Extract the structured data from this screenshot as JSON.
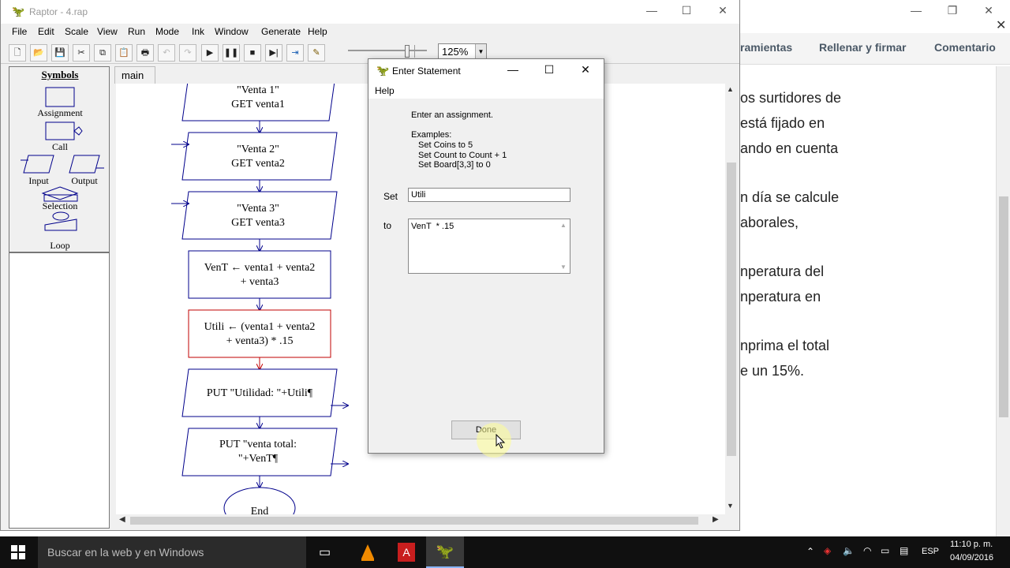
{
  "pdf": {
    "tools": [
      "ramientas",
      "Rellenar y firmar",
      "Comentario"
    ],
    "lines": [
      "os surtidores de",
      "está fijado en",
      "ando en cuenta",
      "n día se calcule",
      "aborales,",
      "nperatura del",
      "nperatura en",
      "nprima el total",
      "e un 15%."
    ]
  },
  "raptor": {
    "title": "Raptor - 4.rap",
    "menu": [
      "File",
      "Edit",
      "Scale",
      "View",
      "Run",
      "Mode",
      "Ink",
      "Window",
      "Generate",
      "Help"
    ],
    "zoom": "125%",
    "symbols": {
      "header": "Symbols",
      "assignment": "Assignment",
      "call": "Call",
      "input": "Input",
      "output": "Output",
      "selection": "Selection",
      "loop": "Loop"
    },
    "tab": "main",
    "flow": {
      "get1_a": "\"Venta 1\"",
      "get1_b": "GET venta1",
      "get2_a": "\"Venta 2\"",
      "get2_b": "GET venta2",
      "get3_a": "\"Venta 3\"",
      "get3_b": "GET venta3",
      "assign1_a": "VenT ← venta1 + venta2",
      "assign1_b": "+ venta3",
      "assign2_a": "Utili ← (venta1 + venta2",
      "assign2_b": "+ venta3)  *  .15",
      "put1": "PUT \"Utilidad: \"+Utili¶",
      "put2_a": "PUT \"venta total:",
      "put2_b": "\"+VenT¶",
      "end": "End"
    }
  },
  "dialog": {
    "title": "Enter Statement",
    "menu": "Help",
    "prompt": "Enter an assignment.",
    "examples_label": "Examples:",
    "ex1": "Set Coins to 5",
    "ex2": "Set Count to Count + 1",
    "ex3": "Set Board[3,3] to 0",
    "set_label": "Set",
    "set_value": "Utili",
    "to_label": "to",
    "to_value": "VenT  * .15",
    "done": "Done"
  },
  "taskbar": {
    "search": "Buscar en la web y en Windows",
    "lang": "ESP",
    "time": "11:10 p. m.",
    "date": "04/09/2016"
  }
}
